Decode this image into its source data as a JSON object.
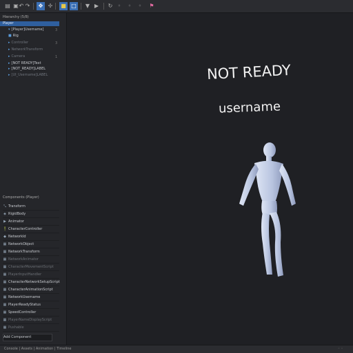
{
  "toolbar": {
    "icons": [
      "folder-icon",
      "save-icon",
      "undo-icon",
      "redo-icon",
      "select-icon",
      "move-icon",
      "scale-icon",
      "play-icon",
      "pause-icon",
      "rotate-icon",
      "reset-icon",
      "refresh-icon",
      "settings-icon",
      "flag-icon"
    ]
  },
  "hierarchy": {
    "title": "Hierarchy (5/8)",
    "root": "Player",
    "items": [
      {
        "label": "[Player]Username]",
        "dim": false
      },
      {
        "label": "Rig",
        "dim": false
      },
      {
        "label": "Controller",
        "dim": true
      },
      {
        "label": "NetworkTransform",
        "dim": true
      },
      {
        "label": "Camera",
        "dim": true
      },
      {
        "label": "[NOT READY]Text",
        "dim": false
      },
      {
        "label": "[NOT_READY]LABEL",
        "dim": false
      },
      {
        "label": "[UI_Username]LABEL",
        "dim": true
      }
    ]
  },
  "components": {
    "title": "Components (Player)",
    "items": [
      {
        "label": "Transform",
        "dim": false
      },
      {
        "label": "RigidBody",
        "dim": false
      },
      {
        "label": "Animator",
        "dim": false
      },
      {
        "label": "CharacterController",
        "dim": false
      },
      {
        "label": "NetworkId",
        "dim": false
      },
      {
        "label": "NetworkObject",
        "dim": false
      },
      {
        "label": "NetworkTransform",
        "dim": false
      },
      {
        "label": "NetworkAnimator",
        "dim": true
      },
      {
        "label": "CharacterMovementScript",
        "dim": true
      },
      {
        "label": "PlayerInputHandler",
        "dim": true
      },
      {
        "label": "CharacterNetworkSetupScript",
        "dim": false
      },
      {
        "label": "CharacterAnimationScript",
        "dim": false
      },
      {
        "label": "NetworkUsername",
        "dim": false
      },
      {
        "label": "PlayerReadyStatus",
        "dim": false
      },
      {
        "label": "SpeedController",
        "dim": false
      },
      {
        "label": "PlayerNameDisplayScript",
        "dim": true
      },
      {
        "label": "Pushable",
        "dim": true
      },
      {
        "label": "Add Component",
        "dim": false
      }
    ]
  },
  "viewport": {
    "status_text": "NOT READY",
    "username_text": "username"
  },
  "statusbar": {
    "text": "Console | Assets | Animation | Timeline"
  }
}
